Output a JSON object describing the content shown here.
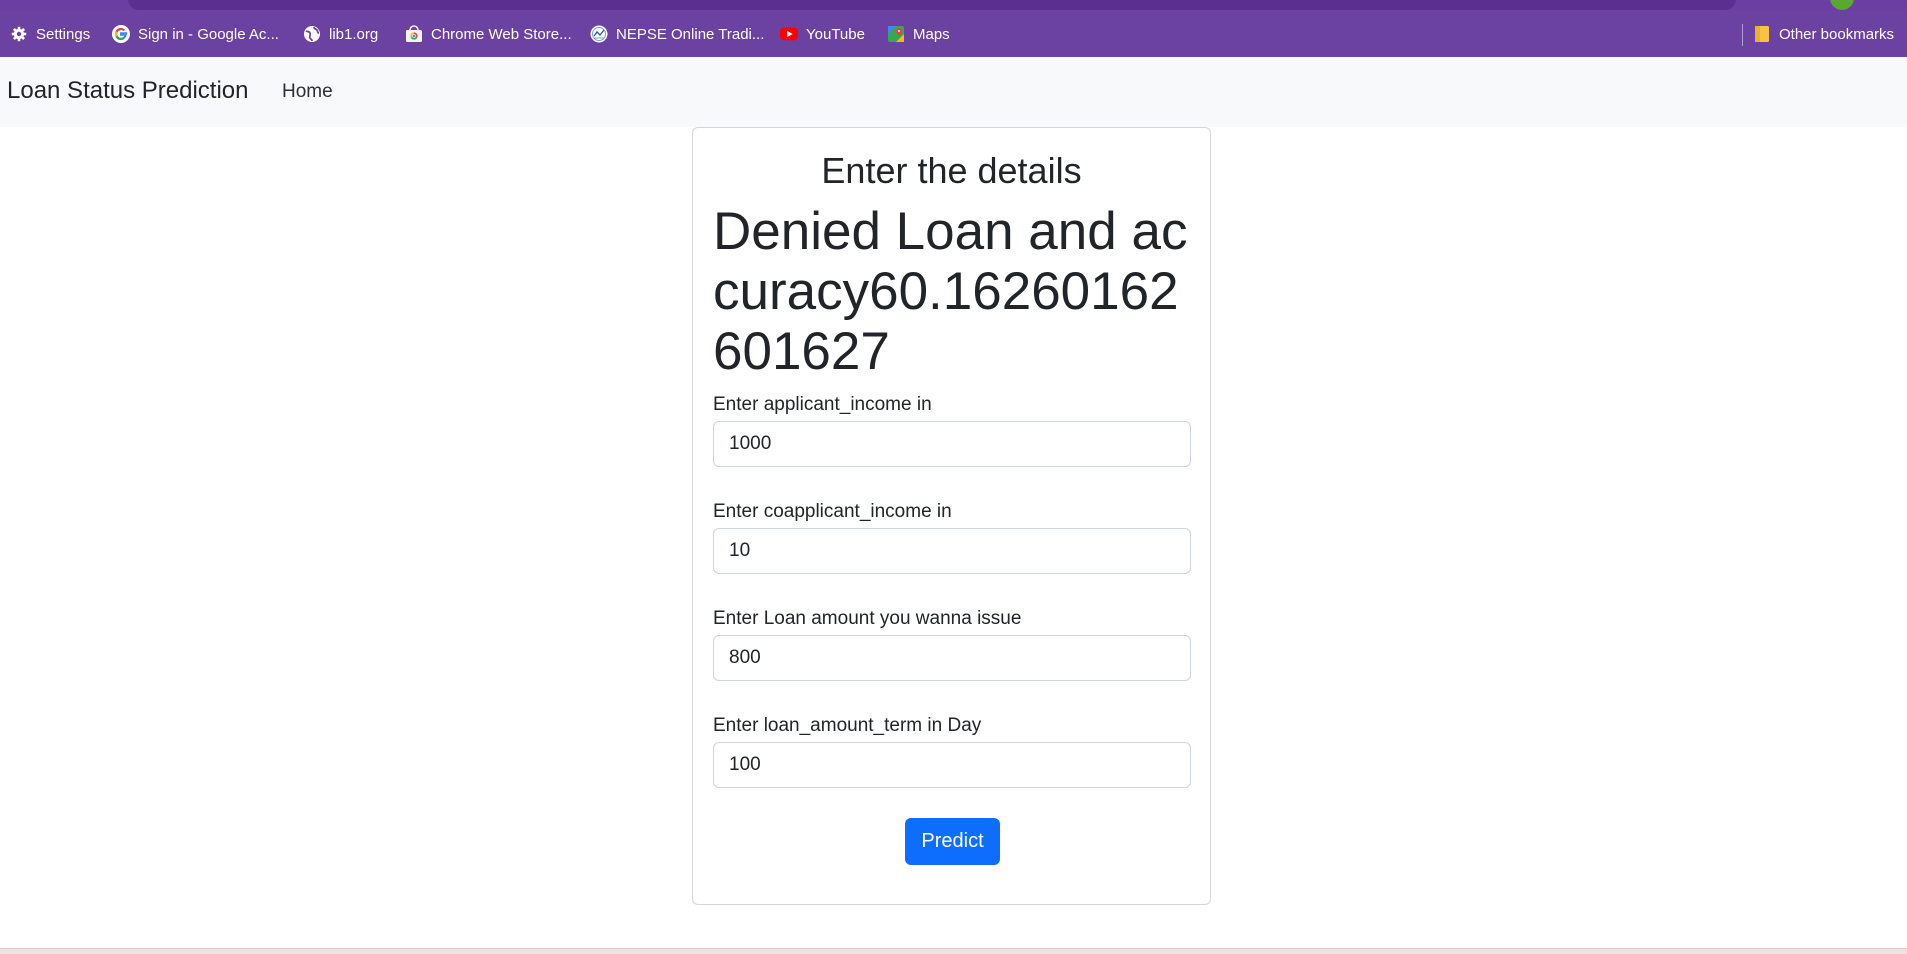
{
  "bookmarks": [
    {
      "label": "Settings",
      "icon": "gear-icon"
    },
    {
      "label": "Sign in - Google Ac...",
      "icon": "google-icon"
    },
    {
      "label": "lib1.org",
      "icon": "globe-icon"
    },
    {
      "label": "Chrome Web Store...",
      "icon": "chrome-web-store-icon"
    },
    {
      "label": "NEPSE Online Tradi...",
      "icon": "nepse-icon"
    },
    {
      "label": "YouTube",
      "icon": "youtube-icon"
    },
    {
      "label": "Maps",
      "icon": "maps-icon"
    }
  ],
  "other_bookmarks": {
    "label": "Other bookmarks",
    "icon": "folder-icon"
  },
  "navbar": {
    "brand": "Loan Status Prediction",
    "home": "Home"
  },
  "card": {
    "title": "Enter the details",
    "result": "Denied Loan and accuracy60.16260162601627"
  },
  "form": {
    "fields": [
      {
        "label": "Enter applicant_income in",
        "value": "1000"
      },
      {
        "label": "Enter coapplicant_income in",
        "value": "10"
      },
      {
        "label": "Enter Loan amount you wanna issue",
        "value": "800"
      },
      {
        "label": "Enter loan_amount_term in Day",
        "value": "100"
      }
    ],
    "submit_label": "Predict"
  },
  "colors": {
    "chrome_purple": "#6b41a2",
    "navbar_bg": "#f8f9fa",
    "primary_button": "#0d6efd"
  }
}
